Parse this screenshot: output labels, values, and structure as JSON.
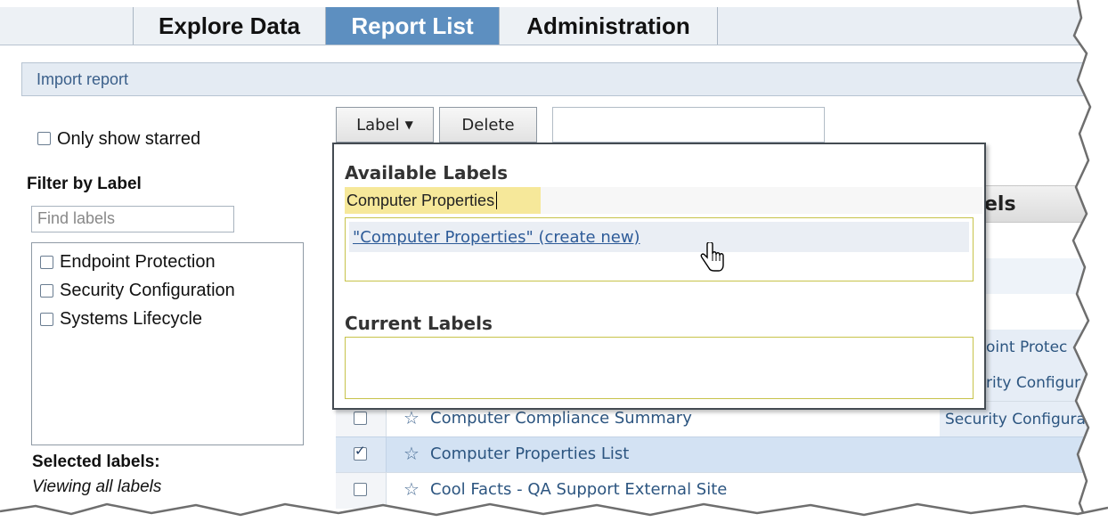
{
  "tabs": [
    {
      "label": "Explore Data",
      "active": false
    },
    {
      "label": "Report List",
      "active": true
    },
    {
      "label": "Administration",
      "active": false
    }
  ],
  "import_report": "Import report",
  "sidebar": {
    "only_show_starred": "Only show starred",
    "filter_by_label": "Filter by Label",
    "find_labels_placeholder": "Find labels",
    "labels": [
      "Endpoint Protection",
      "Security Configuration",
      "Systems Lifecycle"
    ],
    "selected_labels_heading": "Selected labels:",
    "viewing_all": "Viewing all labels"
  },
  "toolbar": {
    "label_button": "Label",
    "delete_button": "Delete"
  },
  "dropdown": {
    "available_heading": "Available Labels",
    "input_value": "Computer Properties",
    "create_option": "\"Computer Properties\" (create new)",
    "current_heading": "Current Labels"
  },
  "table": {
    "labels_header_partial": "els",
    "rows": [
      {
        "checked": false,
        "name": "",
        "label": "oint Protec"
      },
      {
        "checked": false,
        "name": "",
        "label": "rity Configur"
      },
      {
        "checked": false,
        "name": "Computer Compliance Summary",
        "label": "Security Configura"
      },
      {
        "checked": true,
        "name": "Computer Properties List",
        "label": ""
      },
      {
        "checked": false,
        "name": "Cool Facts - QA Support External Site",
        "label": ""
      }
    ]
  },
  "colors": {
    "active_tab": "#5d8fc0",
    "link": "#2d5b98",
    "highlight": "#f6e89a",
    "selected_row": "#d3e2f3"
  }
}
